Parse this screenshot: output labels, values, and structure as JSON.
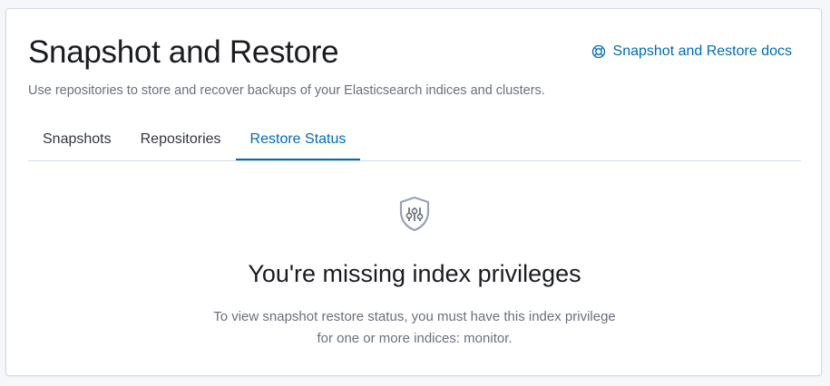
{
  "header": {
    "title": "Snapshot and Restore",
    "docs_link": "Snapshot and Restore docs",
    "description": "Use repositories to store and recover backups of your Elasticsearch indices and clusters."
  },
  "tabs": [
    {
      "label": "Snapshots",
      "active": false
    },
    {
      "label": "Repositories",
      "active": false
    },
    {
      "label": "Restore Status",
      "active": true
    }
  ],
  "empty_state": {
    "icon": "shield-icon",
    "title": "You're missing index privileges",
    "body_line1": "To view snapshot restore status, you must have this index privilege",
    "body_line2": "for one or more indices: monitor."
  },
  "colors": {
    "link": "#006bb4",
    "border": "#d3dae6",
    "text_subdued": "#69707d",
    "title": "#1a1c21"
  }
}
